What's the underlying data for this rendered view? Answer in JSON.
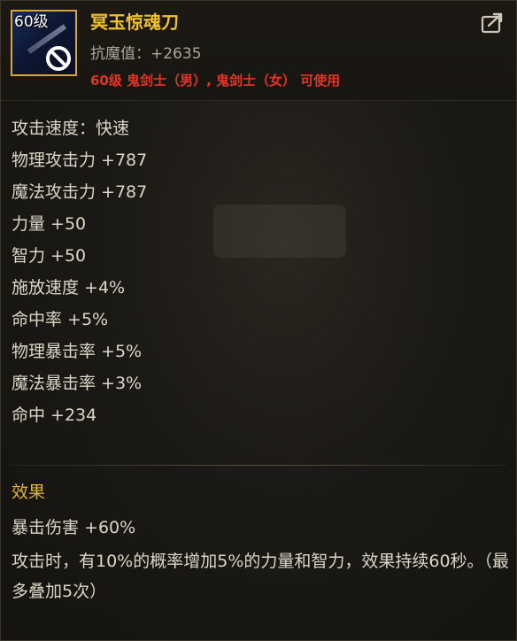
{
  "item": {
    "level_tag": "60级",
    "name": "冥玉惊魂刀",
    "resist_label": "抗魔值",
    "resist_value": "+2635",
    "restriction": "60级 鬼剑士（男）, 鬼剑士（女） 可使用",
    "icon": "sword-icon",
    "unusable_icon": "no-sign-icon",
    "share_icon": "share-icon"
  },
  "stats": [
    "攻击速度：快速",
    "物理攻击力 +787",
    "魔法攻击力 +787",
    "力量 +50",
    "智力 +50",
    "施放速度 +4%",
    "命中率 +5%",
    "物理暴击率 +5%",
    "魔法暴击率 +3%",
    "命中 +234"
  ],
  "effects": {
    "title": "效果",
    "lines": [
      "暴击伤害 +60%",
      "攻击时，有10%的概率增加5%的力量和智力，效果持续60秒。（最多叠加5次）"
    ]
  },
  "colors": {
    "name": "#f0c12c",
    "restriction": "#e53426",
    "effect_title": "#e4b634",
    "text": "#ddd6c7",
    "icon_border": "#d5a53b"
  }
}
